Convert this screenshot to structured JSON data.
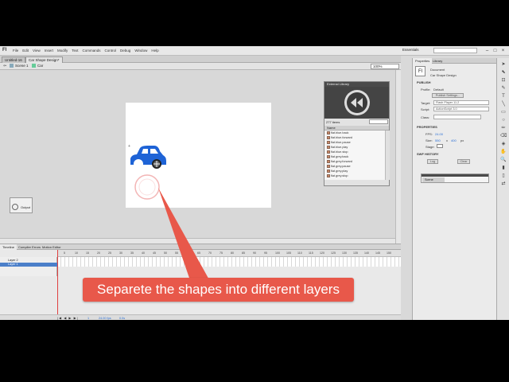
{
  "app": {
    "logo": "Fl"
  },
  "menu": [
    "File",
    "Edit",
    "View",
    "Insert",
    "Modify",
    "Text",
    "Commands",
    "Control",
    "Debug",
    "Window",
    "Help"
  ],
  "workspace": "Essentials",
  "doc_tabs": [
    "Untitled-16",
    "Car Shape Design*"
  ],
  "breadcrumb": {
    "scene": "Scene 1",
    "symbol": "Car"
  },
  "zoom": "100%",
  "output_label": "Output",
  "external_library": {
    "title": "External Library",
    "count": "277 items",
    "column": "Name",
    "items": [
      "flat.blue.back",
      "flat.blue.forward",
      "flat.blue.pause",
      "flat.blue.play",
      "flat.blue.stop",
      "flat.grey.back",
      "flat.grey.forward",
      "flat.grey.pause",
      "flat.grey.play",
      "flat.grey.stop"
    ]
  },
  "timeline": {
    "tabs": [
      "Timeline",
      "Compiler Errors",
      "Motion Editor"
    ],
    "layers": [
      "Layer 2",
      "Layer 1"
    ],
    "ruler": [
      "5",
      "10",
      "15",
      "20",
      "25",
      "30",
      "35",
      "40",
      "45",
      "50",
      "55",
      "60",
      "65",
      "70",
      "75",
      "80",
      "85",
      "90",
      "95",
      "100",
      "105",
      "110",
      "115",
      "120",
      "125",
      "130",
      "135",
      "140",
      "145",
      "150",
      "155",
      "160",
      "165"
    ],
    "footer_values": [
      "1",
      "24.00 fps",
      "0.0s"
    ]
  },
  "properties": {
    "tabs": [
      "Properties",
      "Library"
    ],
    "doc_type": "Document",
    "doc_name": "Car Shape Design",
    "publish_heading": "PUBLISH",
    "profile_label": "Profile:",
    "profile_value": "Default",
    "publish_settings": "Publish Settings...",
    "target_label": "Target:",
    "target_value": "Flash Player 11.2",
    "script_label": "Script:",
    "script_value": "ActionScript 3.0",
    "class_label": "Class:",
    "properties_heading": "PROPERTIES",
    "fps_label": "FPS:",
    "fps_value": "24.00",
    "size_label": "Size:",
    "size_w": "550",
    "size_x": "x",
    "size_h": "400",
    "size_unit": "px",
    "stage_label": "Stage:",
    "swf_heading": "SWF HISTORY",
    "log_btn": "Log",
    "clear_btn": "Clear",
    "scene_label": "Scene"
  },
  "tools": [
    "➤",
    "⬉",
    "⊡",
    "✎",
    "T",
    "╲",
    "▭",
    "○",
    "✏",
    "⌫",
    "◈",
    "✋",
    "🔍",
    "▮",
    "▯",
    "⇄"
  ],
  "callout": "Separete the shapes into different layers",
  "colors": {
    "car": "#1e63d6",
    "callout": "#e8584a",
    "playhead": "#e04040"
  }
}
